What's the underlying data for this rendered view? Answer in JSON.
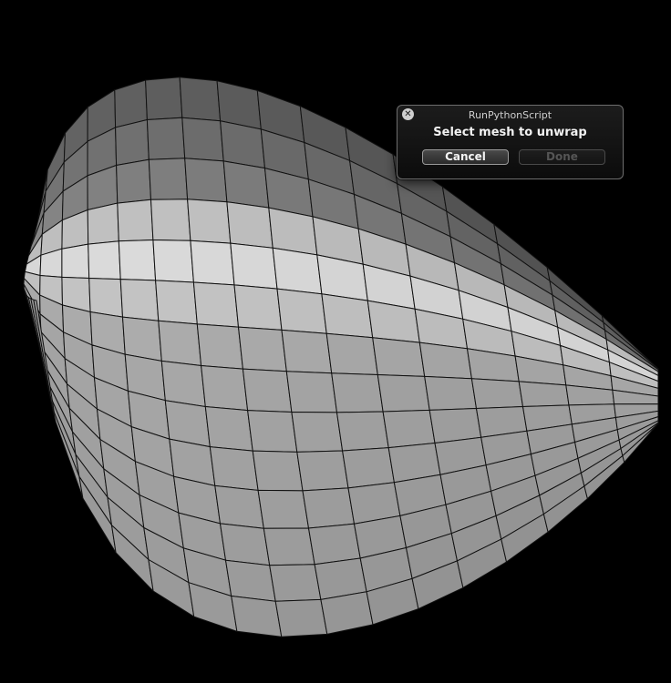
{
  "viewport": {
    "background_color": "#000000",
    "mesh_base_color": "#b5b5b5",
    "mesh_line_color": "#111111"
  },
  "dialog": {
    "title": "RunPythonScript",
    "close_icon": "close-icon",
    "message": "Select mesh to unwrap",
    "cancel_label": "Cancel",
    "done_label": "Done",
    "done_enabled": false
  }
}
